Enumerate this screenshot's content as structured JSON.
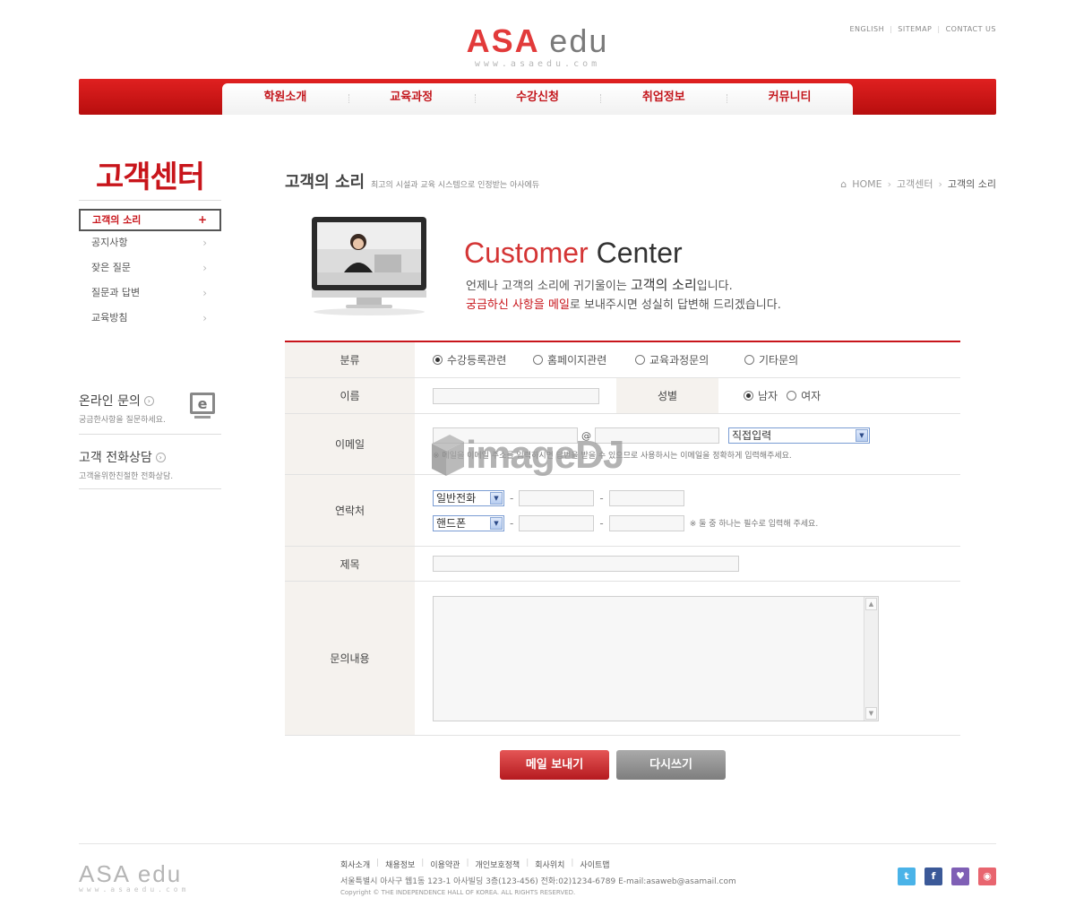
{
  "header": {
    "logo_brand": "ASA",
    "logo_suffix": "edu",
    "logo_url": "www.asaedu.com",
    "util_links": [
      "ENGLISH",
      "SITEMAP",
      "CONTACT US"
    ]
  },
  "gnb": [
    "학원소개",
    "교육과정",
    "수강신청",
    "취업정보",
    "커뮤니티"
  ],
  "lnb": {
    "title": "고객센터",
    "menu": [
      "고객의 소리",
      "공지사항",
      "잦은 질문",
      "질문과 답변",
      "교육방침"
    ],
    "active_index": 0,
    "boxes": [
      {
        "title": "온라인 문의",
        "sub": "궁금한사항을 질문하세요."
      },
      {
        "title": "고객 전화상담",
        "sub": "고객을위한친절한 전화상담."
      }
    ]
  },
  "content": {
    "title": "고객의 소리",
    "subtitle": "최고의 시설과 교육 시스템으로 인정받는 아사에듀",
    "breadcrumb": [
      "HOME",
      "고객센터",
      "고객의 소리"
    ]
  },
  "banner": {
    "title_a": "Customer",
    "title_b": "Center",
    "line1_pre": "언제나 고객의 소리에 귀기울이는 ",
    "line1_big": "고객의 소리",
    "line1_post": "입니다.",
    "line2_red": "궁금하신 사항을 메일",
    "line2_post": "로 보내주시면 성실히 답변해 드리겠습니다."
  },
  "form": {
    "category_label": "분류",
    "category_options": [
      "수강등록관련",
      "홈페이지관련",
      "교육과정문의",
      "기타문의"
    ],
    "category_selected": 0,
    "name_label": "이름",
    "gender_label": "성별",
    "gender_options": [
      "남자",
      "여자"
    ],
    "gender_selected": 0,
    "email_label": "이메일",
    "email_at": "@",
    "email_domain_select": "직접입력",
    "email_note": "※ 메일을 이메일 주소를 입력하시면 답변을 받을 수 있으므로 사용하시는 이메일을 정확하게 입력해주세요.",
    "phone_label": "연락처",
    "phone_type_1": "일반전화",
    "phone_type_2": "핸드폰",
    "phone_dash": "-",
    "phone_note": "※ 둘 중 하나는 필수로 입력해 주세요.",
    "subject_label": "제목",
    "content_label": "문의내용"
  },
  "buttons": {
    "send": "메일 보내기",
    "reset": "다시쓰기"
  },
  "watermark": "imageDJ",
  "footer": {
    "logo_brand": "ASA",
    "logo_suffix": "edu",
    "logo_url": "www.asaedu.com",
    "links": [
      "회사소개",
      "채용정보",
      "이용약관",
      "개인보호정책",
      "회사위치",
      "사이트맵"
    ],
    "address": "서울특별시 아사구 웹1동 123-1 아사빌딩 3층(123-456) 전화:02)1234-6789 E-mail:asaweb@asamail.com",
    "copyright": "Copyright © THE INDEPENDENCE HALL OF KOREA. ALL RIGHTS RESERVED.",
    "sns": [
      {
        "icon": "twitter-icon",
        "glyph": "t",
        "color": "#4ab3e8"
      },
      {
        "icon": "facebook-icon",
        "glyph": "f",
        "color": "#3b5998"
      },
      {
        "icon": "shield-icon",
        "glyph": "♥",
        "color": "#7f5fb5"
      },
      {
        "icon": "blog-icon",
        "glyph": "◉",
        "color": "#e8656f"
      }
    ]
  },
  "colors": {
    "brand_red": "#c8151b",
    "gnb_red": "#d11a1a",
    "button_gray": "#8e8e8e"
  }
}
